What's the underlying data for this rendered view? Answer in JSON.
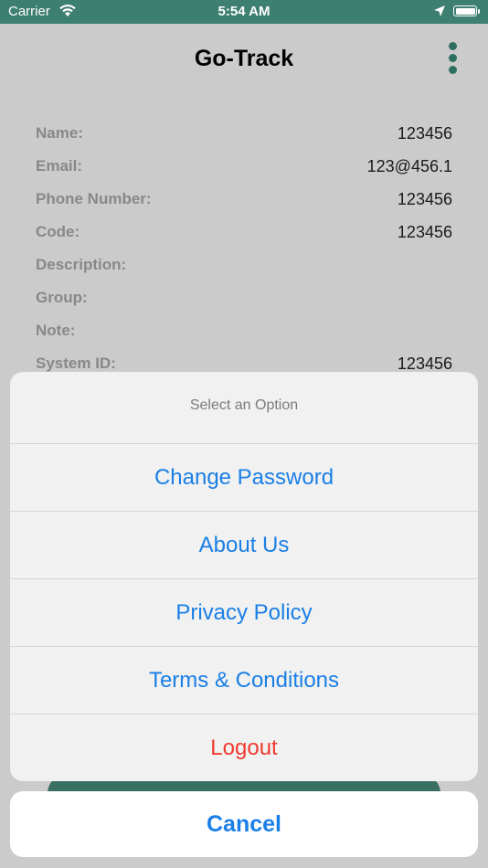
{
  "status_bar": {
    "carrier": "Carrier",
    "time": "5:54 AM"
  },
  "header": {
    "title": "Go-Track",
    "menu_icon": "more-vertical-icon"
  },
  "profile": {
    "rows": [
      {
        "label": "Name:",
        "value": "123456"
      },
      {
        "label": "Email:",
        "value": "123@456.1"
      },
      {
        "label": "Phone Number:",
        "value": "123456"
      },
      {
        "label": "Code:",
        "value": "123456"
      },
      {
        "label": "Description:",
        "value": ""
      },
      {
        "label": "Group:",
        "value": ""
      },
      {
        "label": "Note:",
        "value": ""
      },
      {
        "label": "System ID:",
        "value": "123456"
      }
    ]
  },
  "action_sheet": {
    "title": "Select an Option",
    "options": [
      {
        "label": "Change Password"
      },
      {
        "label": "About Us"
      },
      {
        "label": "Privacy Policy"
      },
      {
        "label": "Terms & Conditions"
      },
      {
        "label": "Logout"
      }
    ],
    "cancel_label": "Cancel"
  },
  "colors": {
    "accent": "#3d7f70",
    "action_blue": "#1a7fe6",
    "destructive_red": "#f03a2e"
  }
}
